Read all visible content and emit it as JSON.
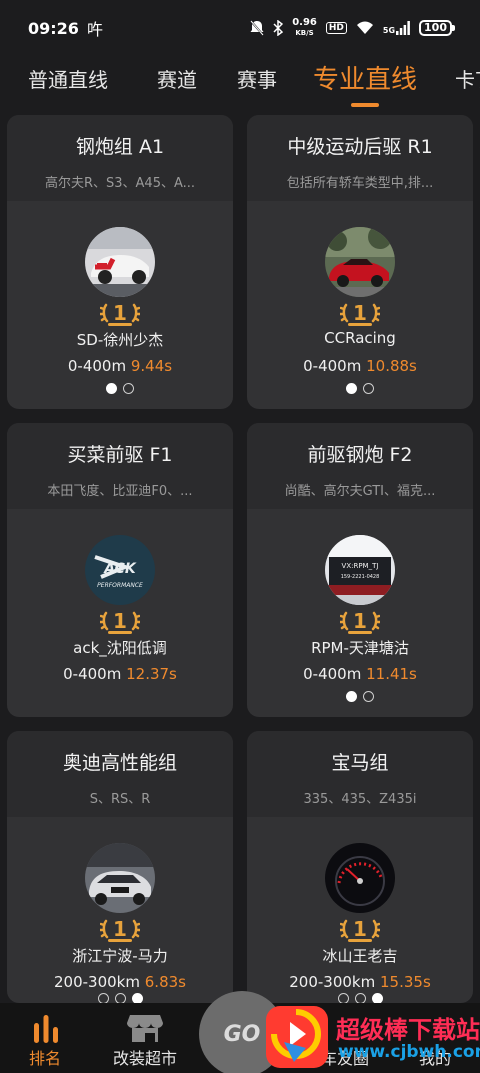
{
  "status_bar": {
    "time": "09:26",
    "carrier": "吘",
    "speed_value": "0.96",
    "speed_unit": "KB/S",
    "hd": "HD",
    "signal": "5G",
    "battery": "100"
  },
  "tabs": [
    "普通直线",
    "赛道",
    "赛事",
    "专业直线",
    "卡丁"
  ],
  "active_tab": "专业直线",
  "cards": [
    {
      "title": "钢炮组 A1",
      "subtitle": "高尔夫R、S3、A45、A...",
      "rank": "1",
      "driver": "SD-徐州少杰",
      "metric": "0-400m",
      "time": "9.44s",
      "pages": 2,
      "page": 1
    },
    {
      "title": "中级运动后驱 R1",
      "subtitle": "包括所有轿车类型中,排...",
      "rank": "1",
      "driver": "CCRacing",
      "metric": "0-400m",
      "time": "10.88s",
      "pages": 2,
      "page": 1
    },
    {
      "title": "买菜前驱 F1",
      "subtitle": "本田飞度、比亚迪F0、...",
      "rank": "1",
      "driver": "ack_沈阳低调",
      "metric": "0-400m",
      "time": "12.37s",
      "pages": 0,
      "page": 0
    },
    {
      "title": "前驱钢炮 F2",
      "subtitle": "尚酷、高尔夫GTI、福克...",
      "rank": "1",
      "driver": "RPM-天津塘沽",
      "metric": "0-400m",
      "time": "11.41s",
      "pages": 2,
      "page": 1
    },
    {
      "title": "奥迪高性能组",
      "subtitle": "S、RS、R",
      "rank": "1",
      "driver": "浙江宁波-马力",
      "metric": "200-300km",
      "time": "6.83s",
      "pages": 3,
      "page": 3
    },
    {
      "title": "宝马组",
      "subtitle": "335、435、Z435i",
      "rank": "1",
      "driver": "冰山王老吉",
      "metric": "200-300km",
      "time": "15.35s",
      "pages": 3,
      "page": 3
    }
  ],
  "avatar_texts": {
    "ack": "ACK",
    "ack_sub": "PERFORMANCE",
    "rpm": "VX:RPM_TJ",
    "rpm_phone": "159-2221-0428"
  },
  "bottom_nav": {
    "rank": "排名",
    "shop": "改装超市",
    "go": "GO",
    "circle": "车友圈",
    "me": "我的"
  },
  "watermark": {
    "title": "超级棒下载站",
    "url": "www.cjbwh.com"
  },
  "colors": {
    "accent": "#ef8a2e",
    "card": "#323234",
    "background": "#1c1c1e",
    "gold": "#e8a33c"
  }
}
